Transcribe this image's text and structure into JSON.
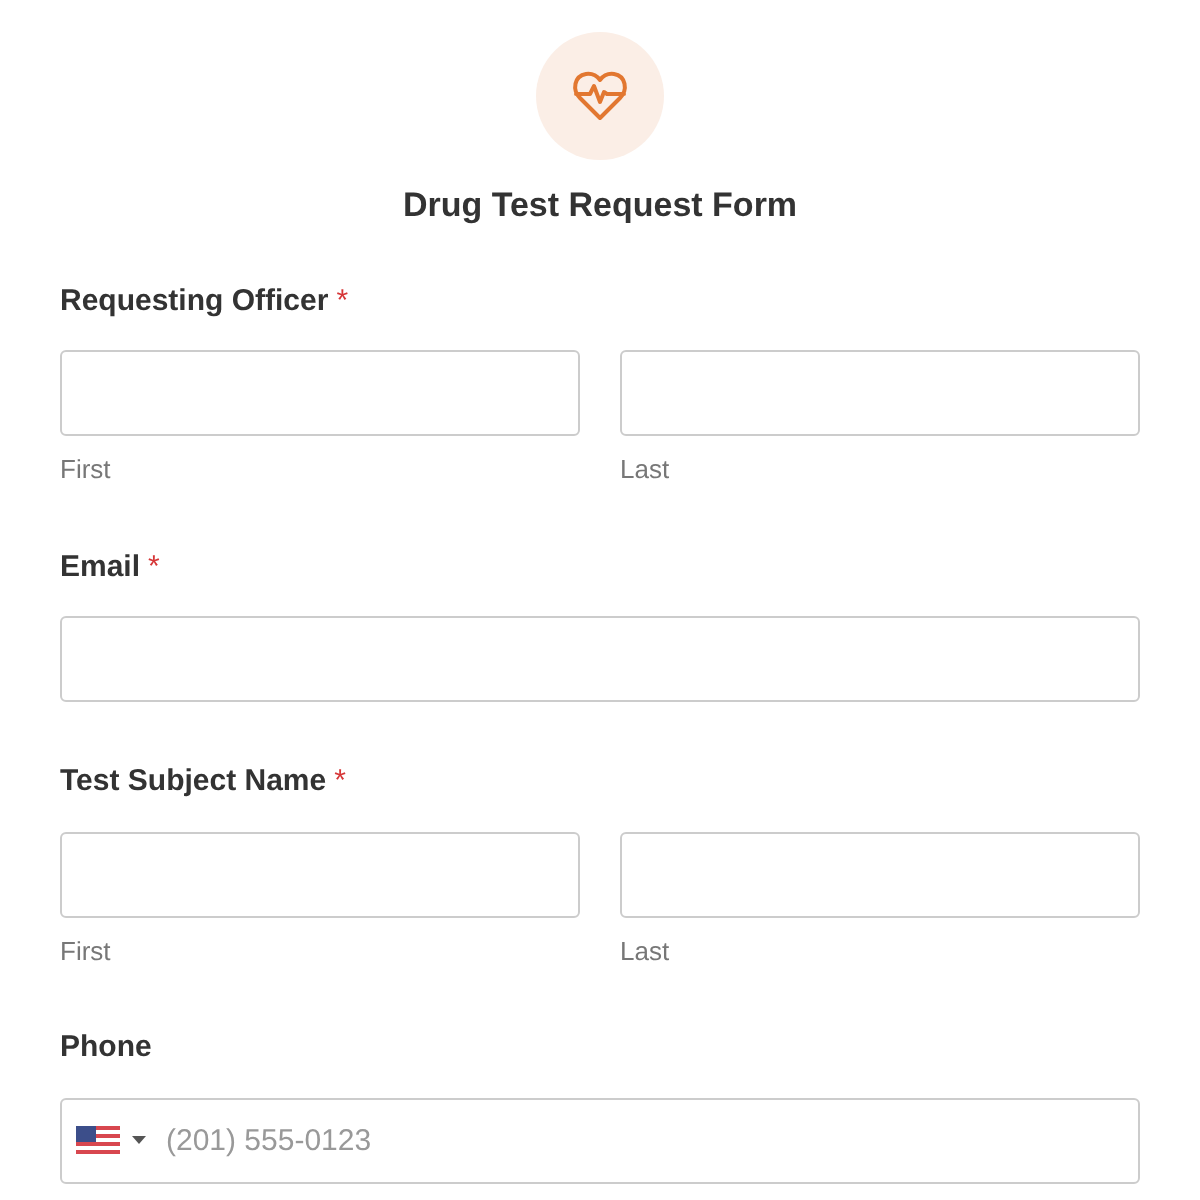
{
  "form": {
    "title": "Drug Test Request Form"
  },
  "fields": [
    {
      "kind": "name",
      "label": "Requesting Officer",
      "required_mark": "*",
      "sublabels": [
        "First",
        "Last"
      ]
    },
    {
      "kind": "email",
      "label": "Email",
      "required_mark": "*"
    },
    {
      "kind": "name",
      "label": "Test Subject Name",
      "required_mark": "*",
      "sublabels": [
        "First",
        "Last"
      ]
    },
    {
      "kind": "phone",
      "label": "Phone",
      "placeholder": "(201) 555-0123"
    }
  ]
}
